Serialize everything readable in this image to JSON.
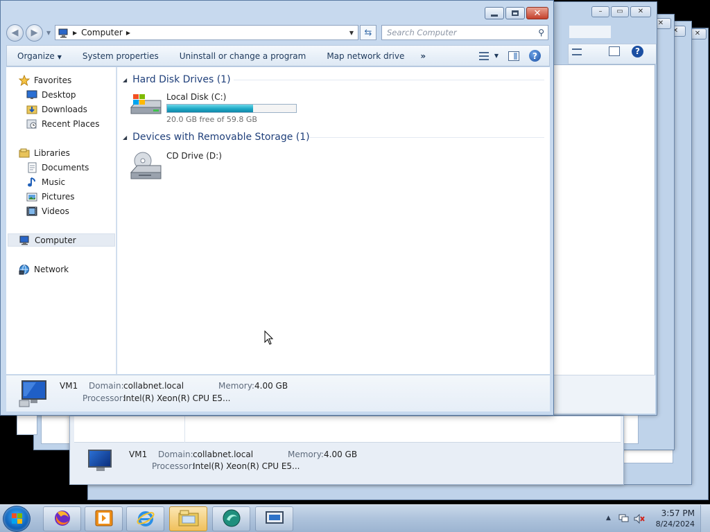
{
  "window": {
    "breadcrumb": [
      "Computer"
    ],
    "search_placeholder": "Search Computer"
  },
  "toolbar": {
    "organize": "Organize",
    "system_properties": "System properties",
    "uninstall": "Uninstall or change a program",
    "map_drive": "Map network drive",
    "more": "»"
  },
  "nav": {
    "favorites": "Favorites",
    "desktop": "Desktop",
    "downloads": "Downloads",
    "recent_places": "Recent Places",
    "libraries": "Libraries",
    "documents": "Documents",
    "music": "Music",
    "pictures": "Pictures",
    "videos": "Videos",
    "computer": "Computer",
    "network": "Network"
  },
  "groups": {
    "hard_disks": "Hard Disk Drives (1)",
    "removable": "Devices with Removable Storage (1)"
  },
  "drives": {
    "c": {
      "name": "Local Disk (C:)",
      "free_text": "20.0 GB free of 59.8 GB",
      "used_fraction": 0.665
    },
    "d": {
      "name": "CD Drive (D:)"
    }
  },
  "details": {
    "name": "VM1",
    "domain_label": "Domain:",
    "domain": "collabnet.local",
    "memory_label": "Memory:",
    "memory": "4.00 GB",
    "processor_label": "Processor:",
    "processor": "Intel(R) Xeon(R) CPU E5..."
  },
  "clock": {
    "time": "3:57 PM",
    "date": "8/24/2024"
  },
  "colors": {
    "accent": "#1f3f7a",
    "capacity_bar": "#1ea9c6",
    "close_button": "#c4402b"
  },
  "icons": {
    "taskbar": [
      "windows-start-icon",
      "firefox-icon",
      "media-player-icon",
      "internet-explorer-icon",
      "file-explorer-icon",
      "app-icon",
      "remote-desktop-icon"
    ]
  }
}
